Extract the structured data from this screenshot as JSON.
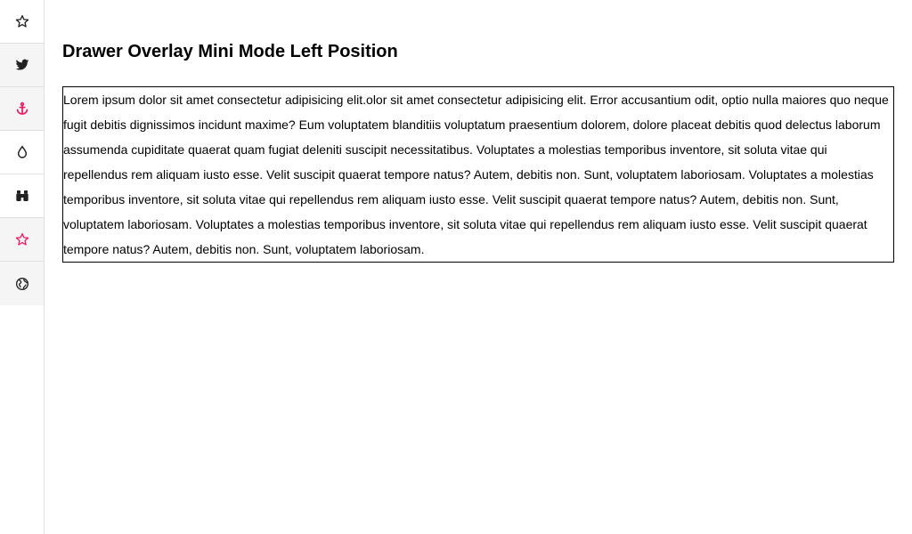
{
  "drawer": {
    "items": [
      {
        "icon": "star-outline-icon",
        "color": "#222222"
      },
      {
        "icon": "twitter-icon",
        "color": "#222222"
      },
      {
        "icon": "anchor-icon",
        "color": "#e91e63"
      },
      {
        "icon": "drop-icon",
        "color": "#222222"
      },
      {
        "icon": "binoculars-icon",
        "color": "#222222"
      },
      {
        "icon": "star-outline-icon",
        "color": "#e91e63"
      },
      {
        "icon": "globe-icon",
        "color": "#222222"
      }
    ]
  },
  "main": {
    "title": "Drawer Overlay Mini Mode Left Position",
    "body": "Lorem ipsum dolor sit amet consectetur adipisicing elit.olor sit amet consectetur adipisicing elit. Error accusantium odit, optio nulla maiores quo neque fugit debitis dignissimos incidunt maxime? Eum voluptatem blanditiis voluptatum praesentium dolorem, dolore placeat debitis quod delectus laborum assumenda cupiditate quaerat quam fugiat deleniti suscipit necessitatibus. Voluptates a molestias temporibus inventore, sit soluta vitae qui repellendus rem aliquam iusto esse. Velit suscipit quaerat tempore natus? Autem, debitis non. Sunt, voluptatem laboriosam. Voluptates a molestias temporibus inventore, sit soluta vitae qui repellendus rem aliquam iusto esse. Velit suscipit quaerat tempore natus? Autem, debitis non. Sunt, voluptatem laboriosam. Voluptates a molestias temporibus inventore, sit soluta vitae qui repellendus rem aliquam iusto esse. Velit suscipit quaerat tempore natus? Autem, debitis non. Sunt, voluptatem laboriosam."
  },
  "colors": {
    "accent": "#e91e63",
    "icon_default": "#222222",
    "shaded_bg": "#f5f5f5",
    "divider": "#e0e0e0"
  }
}
